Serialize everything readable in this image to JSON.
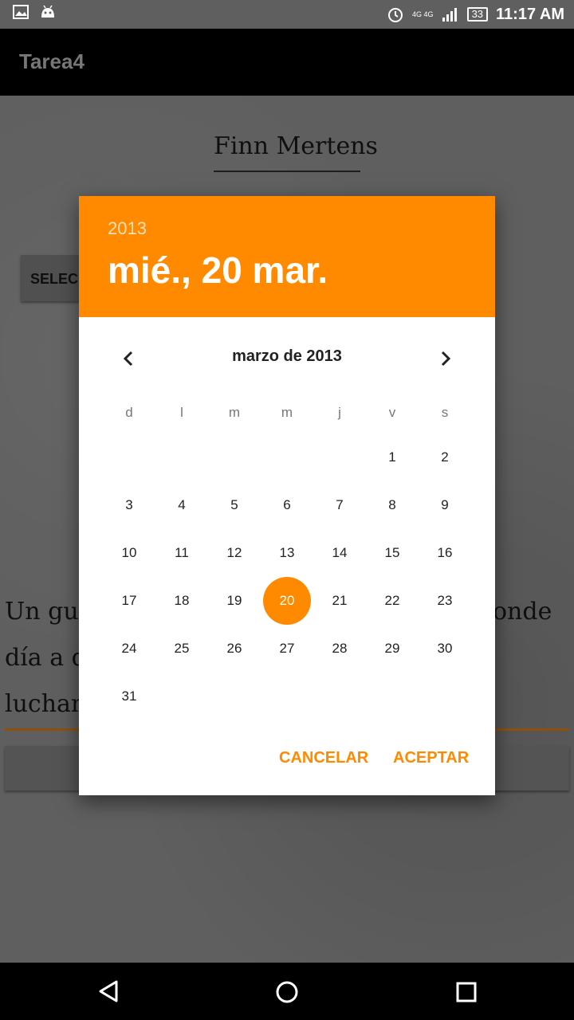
{
  "status_bar": {
    "time": "11:17 AM",
    "battery": "33",
    "network": "4G 4G",
    "icons": [
      "image-icon",
      "android-icon",
      "alarm-icon",
      "signal-icon",
      "battery-icon"
    ]
  },
  "app": {
    "title": "Tarea4"
  },
  "background": {
    "name_field": "Finn Mertens",
    "select_button_partial": "SELEC",
    "paragraph_lines": [
      "Un gue",
      "onde",
      "día a d",
      "luchand"
    ]
  },
  "dialog": {
    "year": "2013",
    "selected_date": "mié., 20 mar.",
    "month_label": "marzo de 2013",
    "weekdays": [
      "d",
      "l",
      "m",
      "m",
      "j",
      "v",
      "s"
    ],
    "first_weekday_index": 5,
    "days_in_month": 31,
    "selected_day": 20,
    "cancel_label": "CANCELAR",
    "accept_label": "ACEPTAR",
    "accent_color": "#ff8a00"
  },
  "nav_bar": {
    "icons": [
      "back-icon",
      "home-icon",
      "recents-icon"
    ]
  }
}
